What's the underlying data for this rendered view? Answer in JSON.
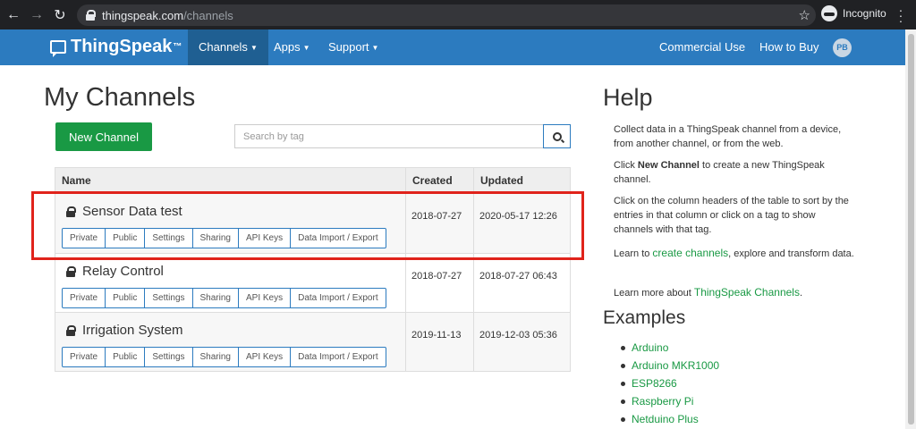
{
  "browser": {
    "url_host": "thingspeak.com",
    "url_path": "/channels",
    "incognito_label": "Incognito"
  },
  "navbar": {
    "brand": "ThingSpeak",
    "brand_mark": "™",
    "channels": "Channels",
    "apps": "Apps",
    "support": "Support",
    "commercial_use": "Commercial Use",
    "how_to_buy": "How to Buy",
    "avatar_initials": "PB"
  },
  "main": {
    "title": "My Channels",
    "new_channel": "New Channel",
    "search_placeholder": "Search by tag",
    "columns": {
      "name": "Name",
      "created": "Created",
      "updated": "Updated"
    },
    "button_labels": {
      "private": "Private",
      "public": "Public",
      "settings": "Settings",
      "sharing": "Sharing",
      "api_keys": "API Keys",
      "import_export": "Data Import / Export"
    },
    "channels": [
      {
        "name": "Sensor Data test",
        "created": "2018-07-27",
        "updated": "2020-05-17 12:26"
      },
      {
        "name": "Relay Control",
        "created": "2018-07-27",
        "updated": "2018-07-27 06:43"
      },
      {
        "name": "Irrigation System",
        "created": "2019-11-13",
        "updated": "2019-12-03 05:36"
      }
    ]
  },
  "help": {
    "title": "Help",
    "p1": "Collect data in a ThingSpeak channel from a device, from another channel, or from the web.",
    "p2_pre": "Click ",
    "p2_bold": "New Channel",
    "p2_post": " to create a new ThingSpeak channel.",
    "p3": "Click on the column headers of the table to sort by the entries in that column or click on a tag to show channels with that tag.",
    "p4_pre": "Learn to ",
    "p4_link": "create channels",
    "p4_post": ", explore and transform data.",
    "p5_pre": "Learn more about ",
    "p5_link": "ThingSpeak Channels",
    "p5_post": "."
  },
  "examples": {
    "title": "Examples",
    "items": [
      "Arduino",
      "Arduino MKR1000",
      "ESP8266",
      "Raspberry Pi",
      "Netduino Plus"
    ]
  },
  "colors": {
    "navbar": "#2c7bbf",
    "accent_green": "#199944",
    "highlight": "#e0231b"
  }
}
